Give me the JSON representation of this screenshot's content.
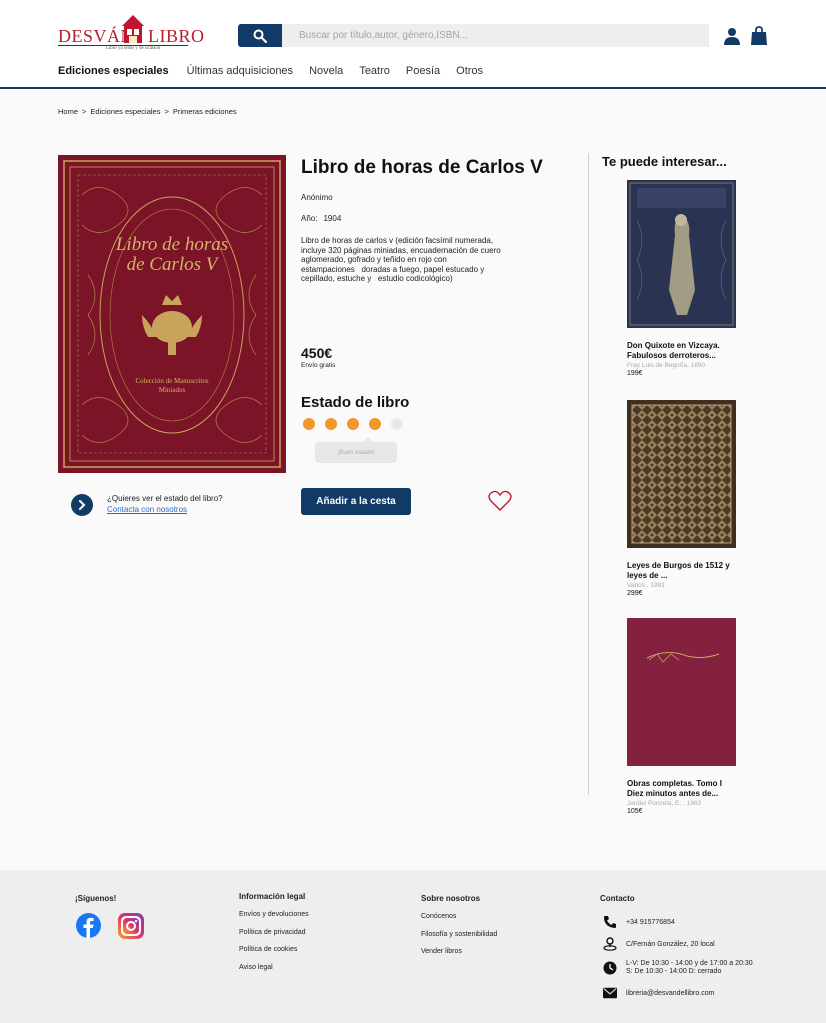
{
  "header": {
    "logo": {
      "word1": "DESVÁN",
      "word2": "LIBRO",
      "tagline": "Libro ya leído y de ocasión"
    },
    "search": {
      "placeholder": "Buscar por título,autor, género,ISBN..."
    },
    "nav": [
      "Ediciones especiales",
      "Últimas adquisiciones",
      "Novela",
      "Teatro",
      "Poesía",
      "Otros"
    ],
    "icons": [
      "search-icon",
      "user-icon",
      "shopping-bag-icon"
    ]
  },
  "breadcrumb": [
    "Home",
    "Ediciones especiales",
    "Primeras ediciones"
  ],
  "product": {
    "title": "Libro de horas de Carlos V",
    "author": "Anónimo",
    "year_label": "Año:",
    "year": "1904",
    "description": "Libro de horas de carlos v (edición facsímil numerada,\nincluye 320 páginas miniadas, encuadernación de cuero\naglomerado, gofrado y teñido en rojo con\nestampaciones   doradas a fuego, papel estucado y\ncepillado, estuche y   estudio codicológico)",
    "price": "450€",
    "shipping": "Envío gratis",
    "state_title": "Estado de libro",
    "state_rating": 4,
    "state_max": 5,
    "state_label": "¡Buen estado!",
    "question": "¿Quieres ver el estado del libro?",
    "contact_link": "Contacta con nosotros",
    "add_button": "Añadir a la cesta",
    "cover": {
      "line1": "Libro de horas",
      "line2": "de Carlos V",
      "small1": "Colección de Manuscritos",
      "small2": "Miniados"
    },
    "colors": {
      "accent": "#123a66",
      "rating": "#f2962e",
      "cover": "#7a1426",
      "heart": "#c0162f"
    }
  },
  "sidebar": {
    "title": "Te puede interesar...",
    "items": [
      {
        "title": "Don Quixote en Vizcaya. Fabulosos derroteros...",
        "meta": "Fray Luis de Begoña, 1890",
        "price": "199€"
      },
      {
        "title": "Leyes de Burgos de 1512 y leyes de ...",
        "meta": "Varios , 1991",
        "price": "299€"
      },
      {
        "title": "Obras completas. Tomo I Diez minutos antes de...",
        "meta": "Jardiel Poncela, E. , 1963",
        "price": "105€"
      }
    ]
  },
  "footer": {
    "follow": {
      "title": "¡Síguenos!"
    },
    "legal": {
      "title": "Información legal",
      "items": [
        "Envíos y devoluciones",
        "Política de privacidad",
        "Política de cookies",
        "Aviso legal"
      ]
    },
    "about": {
      "title": "Sobre nosotros",
      "items": [
        "Conócenos",
        "Filosofía y sostenibilidad",
        "Vender libros"
      ]
    },
    "contact": {
      "title": "Contacto",
      "phone": "+34 915776854",
      "address": "C/Fernán González, 20 local",
      "hours1": "L-V: De 10:30 - 14:00 y de 17:00 a 20:30",
      "hours2": "S: De 10:30 - 14:00 D: cerrado",
      "email": "libreria@desvandellibro.com"
    }
  }
}
